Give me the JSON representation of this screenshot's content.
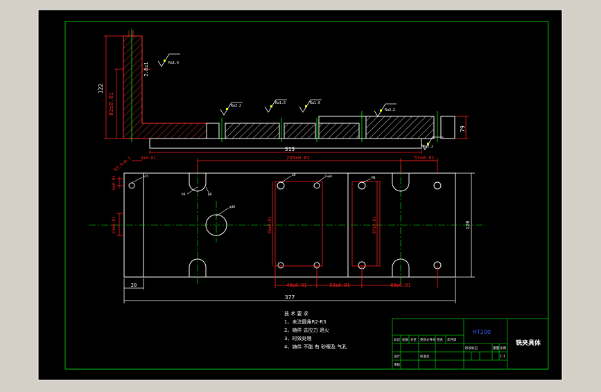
{
  "colors": {
    "workspace": "#d4d0c8",
    "sheet": "#000000",
    "frame": "#00c000",
    "outline": "#ffffff",
    "dimension": "#ff2020",
    "center": "#00ff00",
    "hatch": "#ffffff",
    "marker": "#ffff00",
    "text": "#ffffff"
  },
  "top_view": {
    "dims": {
      "height_overall": "122",
      "height_inner": "82±0.01",
      "height_right": "79",
      "length": "313",
      "wall_thickness": "2.8±1"
    },
    "roughness": [
      "Ra1.6",
      "Ra3.2",
      "Ra1.6",
      "Ra1.6",
      "Ra3.2",
      "Ra3.2"
    ]
  },
  "plan_view": {
    "dims": {
      "hole_spacing_top": "235±0.01",
      "right_spacing_top": "57±0.01",
      "small_offset": "4±0.01",
      "left_vertical": "9±0.01",
      "left_mid": "23±0.01",
      "center_v1": "95±0.01",
      "center_v2": "97±0.01",
      "height": "120",
      "left_edge": "20",
      "bottom_1": "40±0.01",
      "bottom_2": "53±0.01",
      "bottom_3": "88±0.01",
      "overall": "377",
      "chamfer": "R3.5+0.1"
    },
    "labels": {
      "hole_a": "φ15",
      "hole_b": "φ8",
      "hole_c": "2×φ8",
      "hole_d": "φ40",
      "hole_e": "M8",
      "hole_f": "R8",
      "hole_g": "φ8"
    }
  },
  "notes": {
    "heading": "技 术 要 求",
    "items": [
      "1、未注圆角R2-R3",
      "2、铸件 去应力 退火",
      "3、时效处理",
      "4、铸件 不能 有 砂眼及 气孔"
    ]
  },
  "title_block": {
    "material": "HT200",
    "drawing_name": "铣夹具体",
    "header_row": [
      "标记",
      "处数",
      "分区",
      "更改文件号",
      "签名",
      "年月日"
    ],
    "row_labels": [
      "设计",
      "审核"
    ],
    "standard_label": "标准化",
    "stage_labels": [
      "阶段标记",
      "重量",
      "比例"
    ],
    "scale": "1:1"
  }
}
